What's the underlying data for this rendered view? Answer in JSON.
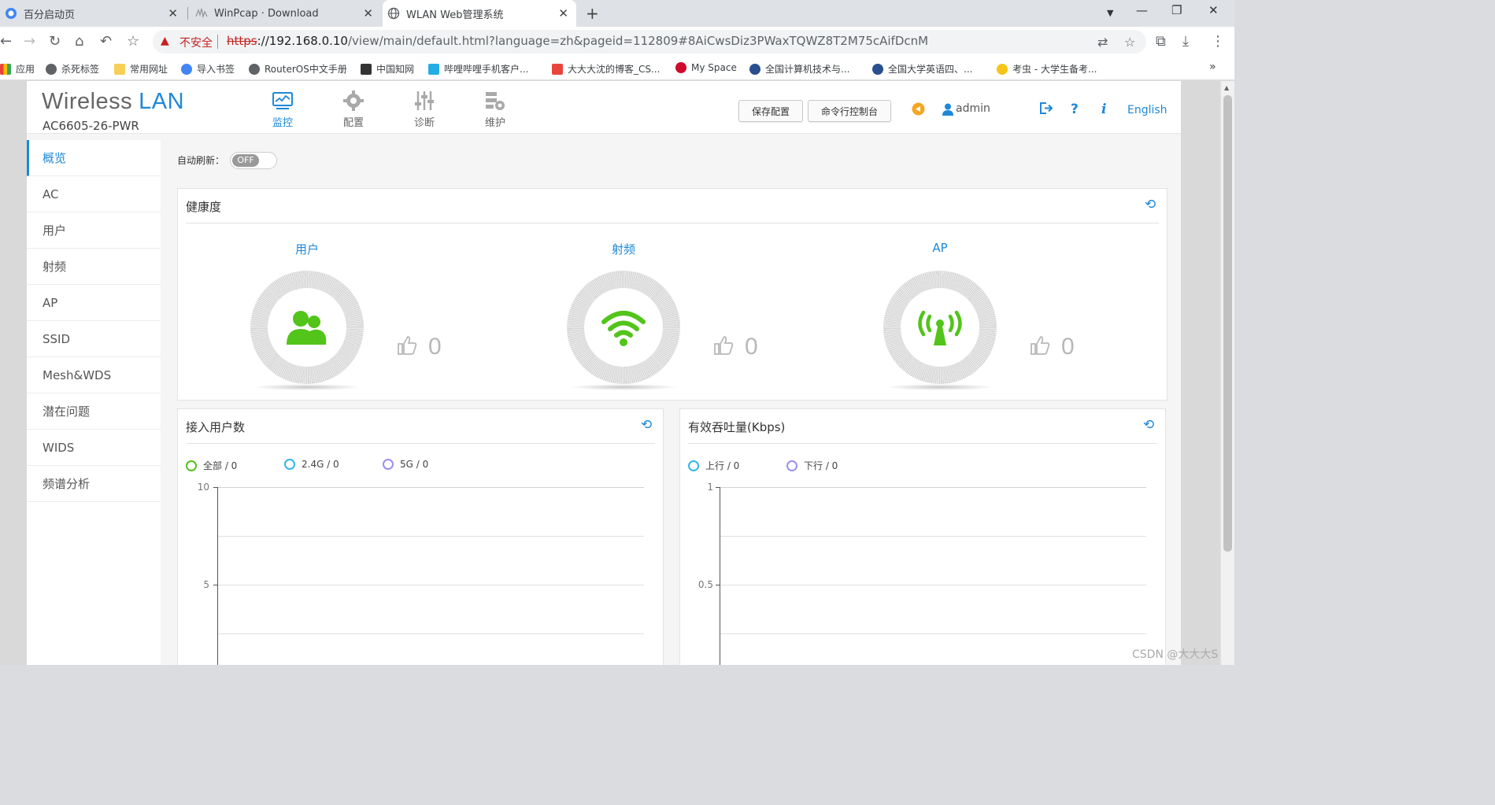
{
  "browser": {
    "tabs": [
      {
        "title": "百分启动页",
        "active": false
      },
      {
        "title": "WinPcap · Download",
        "active": false
      },
      {
        "title": "WLAN Web管理系统",
        "active": true
      }
    ],
    "new_tab": "+",
    "url_security": "不安全",
    "url_protocol": "https",
    "url_host": "://192.168.0.10",
    "url_rest": "/view/main/default.html?language=zh&pageid=112809#8AiCwsDiz3PWaxTQWZ8T2M75cAifDcnM",
    "bookmarks": [
      {
        "label": "应用",
        "color": "#1a73e8"
      },
      {
        "label": "杀死标签",
        "color": "#5f6368"
      },
      {
        "label": "常用网址",
        "color": "#f9cf58"
      },
      {
        "label": "导入书签",
        "color": "#4285f4"
      },
      {
        "label": "RouterOS中文手册",
        "color": "#5f6368"
      },
      {
        "label": "中国知网",
        "color": "#333333"
      },
      {
        "label": "哔哩哔哩手机客户...",
        "color": "#23ade5"
      },
      {
        "label": "大大大沈的博客_CS...",
        "color": "#e8453c"
      },
      {
        "label": "My Space",
        "color": "#cf0a2c"
      },
      {
        "label": "全国计算机技术与...",
        "color": "#2a4f8f"
      },
      {
        "label": "全国大学英语四、...",
        "color": "#2a4f8f"
      },
      {
        "label": "考虫 - 大学生备考...",
        "color": "#f5c518"
      }
    ],
    "more_bookmarks": "»"
  },
  "header": {
    "logo_main": "Wireless",
    "logo_accent": "LAN",
    "model": "AC6605-26-PWR",
    "nav": [
      {
        "label": "监控",
        "icon": "monitor-icon",
        "active": true
      },
      {
        "label": "配置",
        "icon": "gear-icon",
        "active": false
      },
      {
        "label": "诊断",
        "icon": "sliders-icon",
        "active": false
      },
      {
        "label": "维护",
        "icon": "maintenance-icon",
        "active": false
      }
    ],
    "save_config": "保存配置",
    "cli_console": "命令行控制台",
    "user": "admin",
    "language": "English"
  },
  "sidebar": {
    "items": [
      {
        "label": "概览",
        "active": true
      },
      {
        "label": "AC"
      },
      {
        "label": "用户"
      },
      {
        "label": "射频"
      },
      {
        "label": "AP"
      },
      {
        "label": "SSID"
      },
      {
        "label": "Mesh&WDS"
      },
      {
        "label": "潜在问题"
      },
      {
        "label": "WIDS"
      },
      {
        "label": "频谱分析"
      }
    ]
  },
  "auto_refresh": {
    "label": "自动刷新：",
    "state": "OFF"
  },
  "health": {
    "title": "健康度",
    "items": [
      {
        "label": "用户",
        "icon": "users-icon",
        "score": "0"
      },
      {
        "label": "射频",
        "icon": "wifi-icon",
        "score": "0"
      },
      {
        "label": "AP",
        "icon": "antenna-icon",
        "score": "0"
      }
    ]
  },
  "users_chart": {
    "title": "接入用户数",
    "legend": [
      {
        "label": "全部 / 0",
        "color": "#52c41a"
      },
      {
        "label": "2.4G / 0",
        "color": "#36b6e6"
      },
      {
        "label": "5G / 0",
        "color": "#9b8ff0"
      }
    ],
    "y_ticks": [
      "10",
      "5"
    ]
  },
  "throughput_chart": {
    "title": "有效吞吐量(Kbps)",
    "legend": [
      {
        "label": "上行 / 0",
        "color": "#36b6e6"
      },
      {
        "label": "下行 / 0",
        "color": "#9b8ff0"
      }
    ],
    "y_ticks": [
      "1",
      "0.5"
    ]
  },
  "chart_data": [
    {
      "type": "line",
      "title": "接入用户数",
      "series": [
        {
          "name": "全部",
          "values": [
            0
          ]
        },
        {
          "name": "2.4G",
          "values": [
            0
          ]
        },
        {
          "name": "5G",
          "values": [
            0
          ]
        }
      ],
      "ylim": [
        0,
        10
      ],
      "grid": true
    },
    {
      "type": "line",
      "title": "有效吞吐量(Kbps)",
      "series": [
        {
          "name": "上行",
          "values": [
            0
          ]
        },
        {
          "name": "下行",
          "values": [
            0
          ]
        }
      ],
      "ylim": [
        0,
        1
      ],
      "grid": true
    }
  ],
  "watermark": "CSDN @大大大S",
  "colors": {
    "accent": "#1e88d8",
    "green": "#52c41a"
  }
}
